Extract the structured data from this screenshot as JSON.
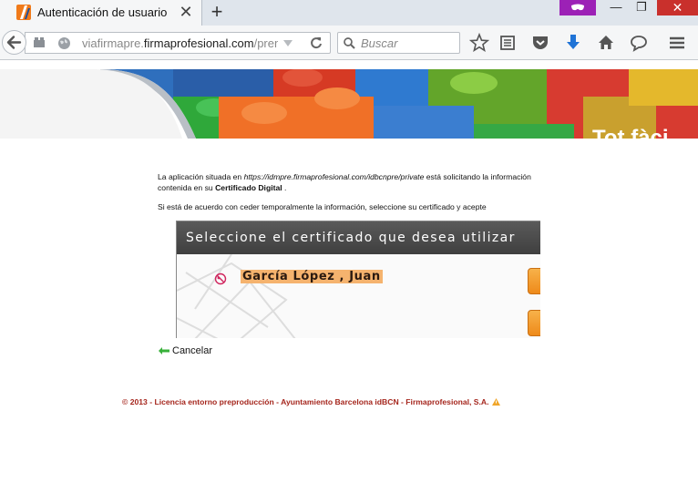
{
  "browser": {
    "tab_title": "Autenticación de usuario",
    "tab_close": "✕",
    "new_tab": "+",
    "minimize": "—",
    "restore": "❐",
    "close": "✕",
    "url_prefix": "viafirmapre.",
    "url_host": "firmaprofesional.com",
    "url_suffix": "/premc",
    "search_placeholder": "Buscar",
    "accent_private": "#9c21b6",
    "accent_download": "#1f73d6"
  },
  "banner": {
    "text": "Tot fàci"
  },
  "page": {
    "intro_a": "La aplicación situada en ",
    "intro_url": "https://idmpre.firmaprofesional.com/idbcnpre/private",
    "intro_b": " está solicitando la información contenida en su ",
    "intro_strong": "Certificado Digital",
    "intro_end": " .",
    "intro2": "Si está de acuerdo con ceder temporalmente la información, seleccione su certificado y acepte",
    "cert_header": "Seleccione el certificado que desea utilizar",
    "cert_name": "García López , Juan",
    "cancel_label": "Cancelar",
    "footer": "© 2013 - Licencia entorno preproducción - Ayuntamiento Barcelona idBCN - Firmaprofesional, S.A.",
    "accent_orange": "#f5b36e",
    "footer_color": "#a5261d"
  }
}
